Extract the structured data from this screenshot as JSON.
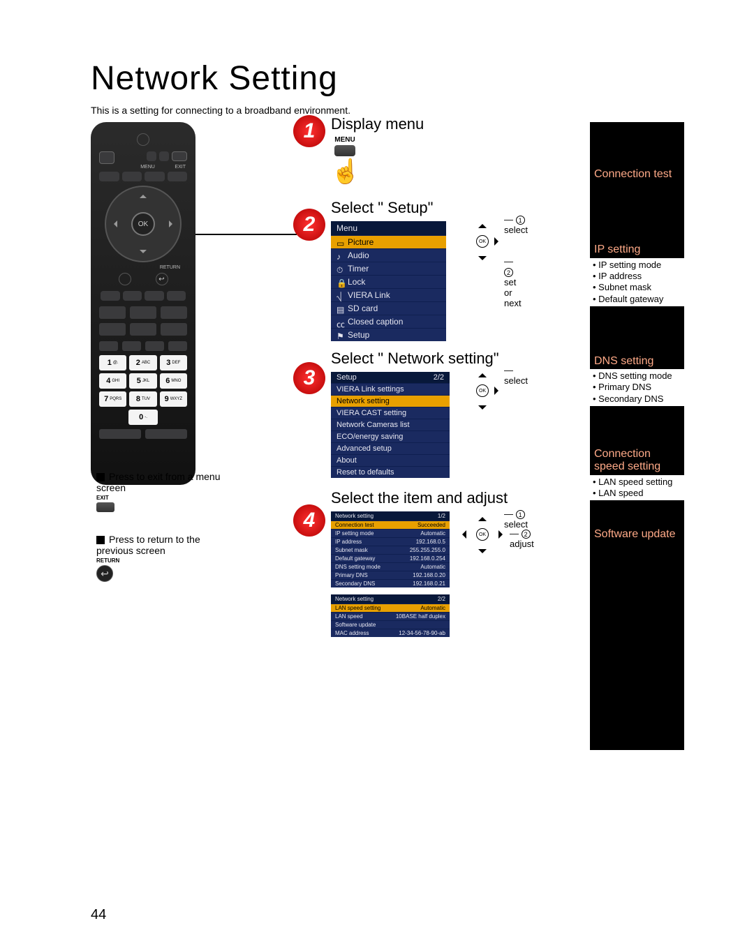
{
  "page": {
    "title": "Network Setting",
    "subtitle": "This is a setting for connecting to a broadband environment.",
    "number": "44"
  },
  "remote": {
    "menu_label": "MENU",
    "exit_label": "EXIT",
    "return_label": "RETURN",
    "return_symbol": "↩",
    "ok": "OK",
    "keys": [
      {
        "n": "1",
        "s": "@."
      },
      {
        "n": "2",
        "s": "ABC"
      },
      {
        "n": "3",
        "s": "DEF"
      },
      {
        "n": "4",
        "s": "GHI"
      },
      {
        "n": "5",
        "s": "JKL"
      },
      {
        "n": "6",
        "s": "MNO"
      },
      {
        "n": "7",
        "s": "PQRS"
      },
      {
        "n": "8",
        "s": "TUV"
      },
      {
        "n": "9",
        "s": "WXYZ"
      },
      {
        "n": "0",
        "s": "-."
      }
    ]
  },
  "hints": {
    "exit_title": "Press to exit from a menu screen",
    "exit_mini": "EXIT",
    "return_title": "Press to return to the previous screen",
    "return_mini": "RETURN"
  },
  "steps": {
    "s1": {
      "n": "1",
      "heading": "Display menu",
      "menu": "MENU",
      "hand": "☝"
    },
    "s2": {
      "n": "2",
      "heading": "Select \" Setup\"",
      "menu_title": "Menu",
      "items": [
        "Picture",
        "Audio",
        "Timer",
        "Lock",
        "VIERA Link",
        "SD card",
        "Closed caption",
        "Setup"
      ],
      "note1": "select",
      "note2": "set or next",
      "ok": "OK"
    },
    "s3": {
      "n": "3",
      "heading": "Select \" Network setting\"",
      "menu_title": "Setup",
      "page": "2/2",
      "items": [
        "VIERA Link settings",
        "Network setting",
        "VIERA CAST setting",
        "Network Cameras list",
        "ECO/energy saving",
        "Advanced setup",
        "About",
        "Reset to defaults"
      ],
      "note1": "select",
      "ok": "OK"
    },
    "s4": {
      "n": "4",
      "heading": "Select the item and adjust",
      "menu1_title": "Network setting",
      "menu1_page": "1/2",
      "rows1": [
        [
          "Connection test",
          "Succeeded"
        ],
        [
          "IP setting mode",
          "Automatic"
        ],
        [
          "IP address",
          "192.168.0.5"
        ],
        [
          "Subnet mask",
          "255.255.255.0"
        ],
        [
          "Default gateway",
          "192.168.0.254"
        ],
        [
          "DNS setting mode",
          "Automatic"
        ],
        [
          "Primary DNS",
          "192.168.0.20"
        ],
        [
          "Secondary DNS",
          "192.168.0.21"
        ]
      ],
      "menu2_title": "Network setting",
      "menu2_page": "2/2",
      "rows2": [
        [
          "LAN speed setting",
          "Automatic"
        ],
        [
          "LAN speed",
          "10BASE half duplex"
        ],
        [
          "Software update",
          ""
        ],
        [
          "MAC address",
          "12-34-56-78-90-ab"
        ]
      ],
      "note1": "select",
      "note2": "adjust",
      "ok": "OK"
    }
  },
  "sidebar": {
    "blocks": [
      {
        "h": "Connection test",
        "items": []
      },
      {
        "h": "IP setting",
        "items": [
          "IP setting mode",
          "IP address",
          "Subnet mask",
          "Default gateway"
        ]
      },
      {
        "h": "DNS setting",
        "items": [
          "DNS setting mode",
          "Primary DNS",
          "Secondary DNS"
        ]
      },
      {
        "h": "Connection speed setting",
        "items": [
          "LAN speed setting",
          "LAN speed"
        ]
      },
      {
        "h": "Software update",
        "items": []
      }
    ]
  }
}
